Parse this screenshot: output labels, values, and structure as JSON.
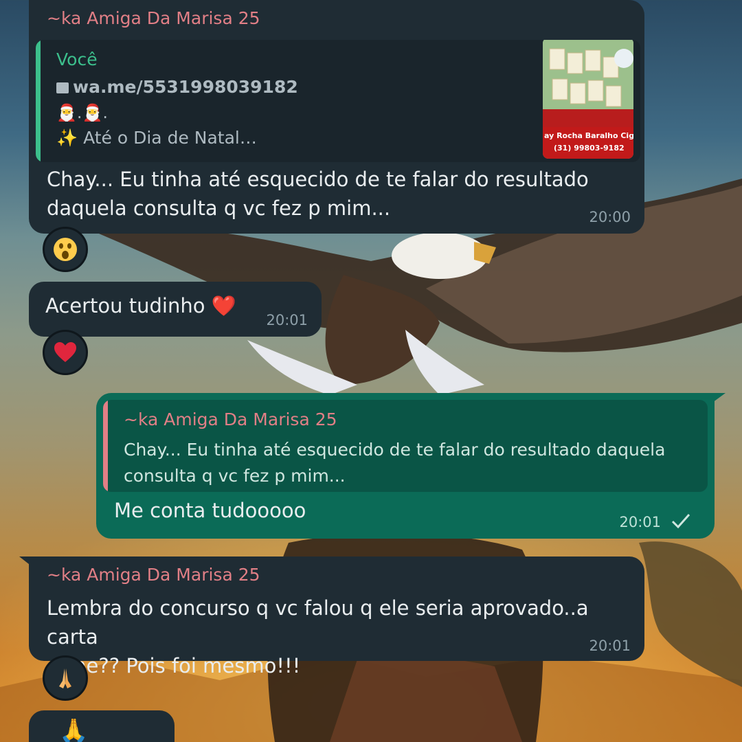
{
  "messages": [
    {
      "sender": "~ka Amiga Da Marisa 25",
      "quote": {
        "author": "Você",
        "link": "wa.me/5531998039182",
        "line2": "🎅.🎅.",
        "line3": "✨ Até o Dia de Natal…",
        "thumb_caption_1": "ay Rocha Baralho Cig",
        "thumb_caption_2": "(31) 99803-9182"
      },
      "text_line1": "Chay... Eu tinha até esquecido de te falar do resultado",
      "text_line2": "daquela consulta q vc fez p mim...",
      "time": "20:00",
      "reaction": "astonished-face"
    },
    {
      "text": "Acertou tudinho ❤️",
      "time": "20:01",
      "reaction": "red-heart"
    },
    {
      "quote": {
        "author": "~ka Amiga Da Marisa 25",
        "line1": "Chay... Eu tinha até esquecido de te falar do resultado daquela",
        "line2": "consulta q vc fez p mim..."
      },
      "text": "Me conta tudooooo",
      "time": "20:01",
      "status": "check-icon"
    },
    {
      "sender": "~ka Amiga Da Marisa 25",
      "text_line1": "Lembra do concurso q vc falou q ele seria aprovado..a carta",
      "text_line2": "cisne?? Pois foi mesmo!!!",
      "time": "20:01",
      "reaction": "folded-hands"
    },
    {
      "text": "🙏"
    }
  ],
  "colors": {
    "incoming_bubble": "#1f2c34",
    "outgoing_bubble": "#0b6b57",
    "sender_name": "#e17f86",
    "quote_you": "#3cbf8c",
    "quote_other": "#e17f86"
  }
}
